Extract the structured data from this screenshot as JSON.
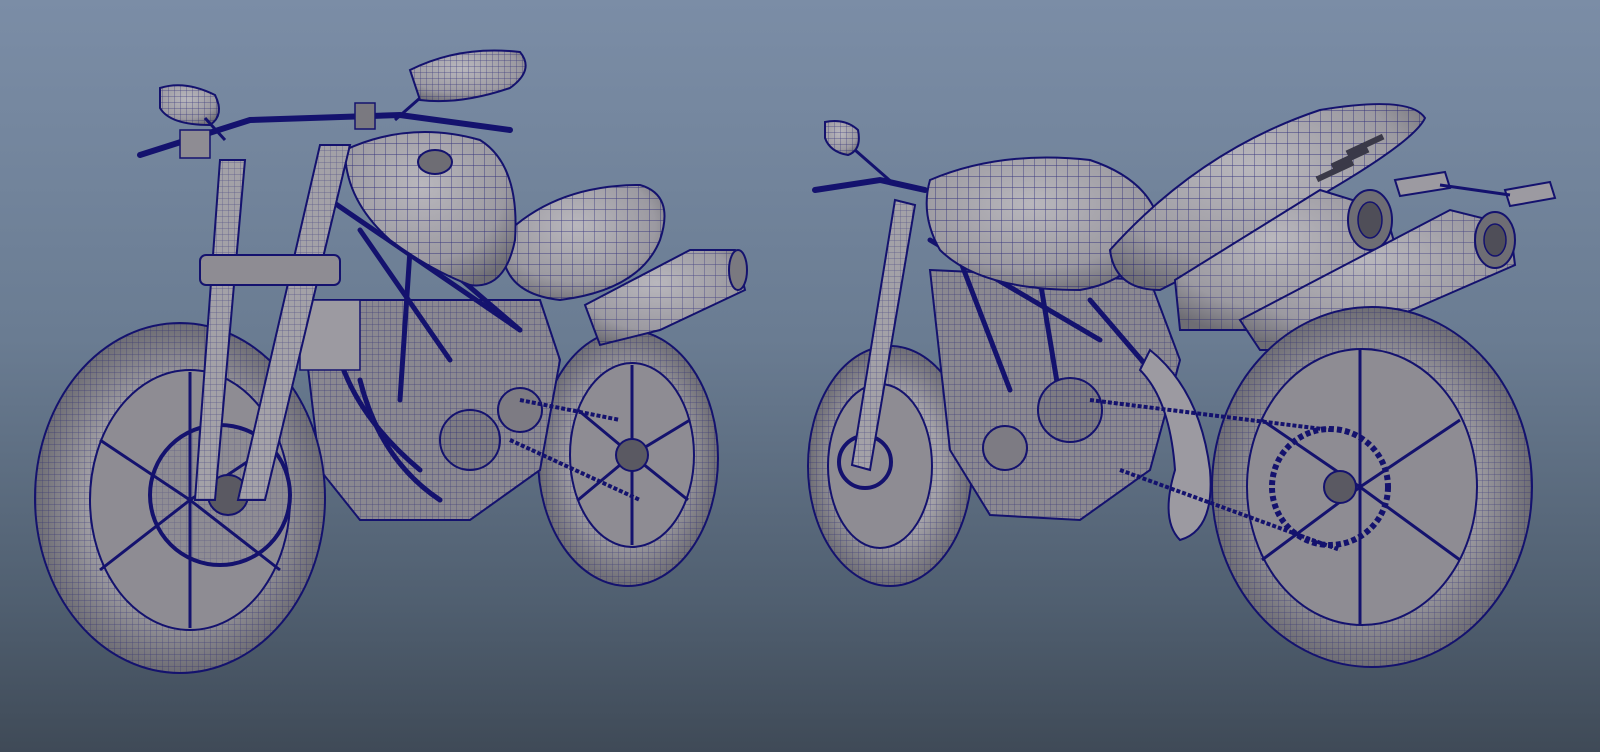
{
  "viewport": {
    "view": "perspective",
    "display_mode": "wireframe-on-shaded",
    "background_gradient": [
      "#7b8da6",
      "#6a7c92",
      "#505f70",
      "#3f4a57"
    ],
    "surface_color": "#9f9da3",
    "surface_shadow_color": "#6e6d74",
    "wire_color": "#14126e"
  },
  "models": [
    {
      "name": "motorcycle",
      "view": "front-three-quarter"
    },
    {
      "name": "motorcycle",
      "view": "rear-three-quarter"
    }
  ]
}
